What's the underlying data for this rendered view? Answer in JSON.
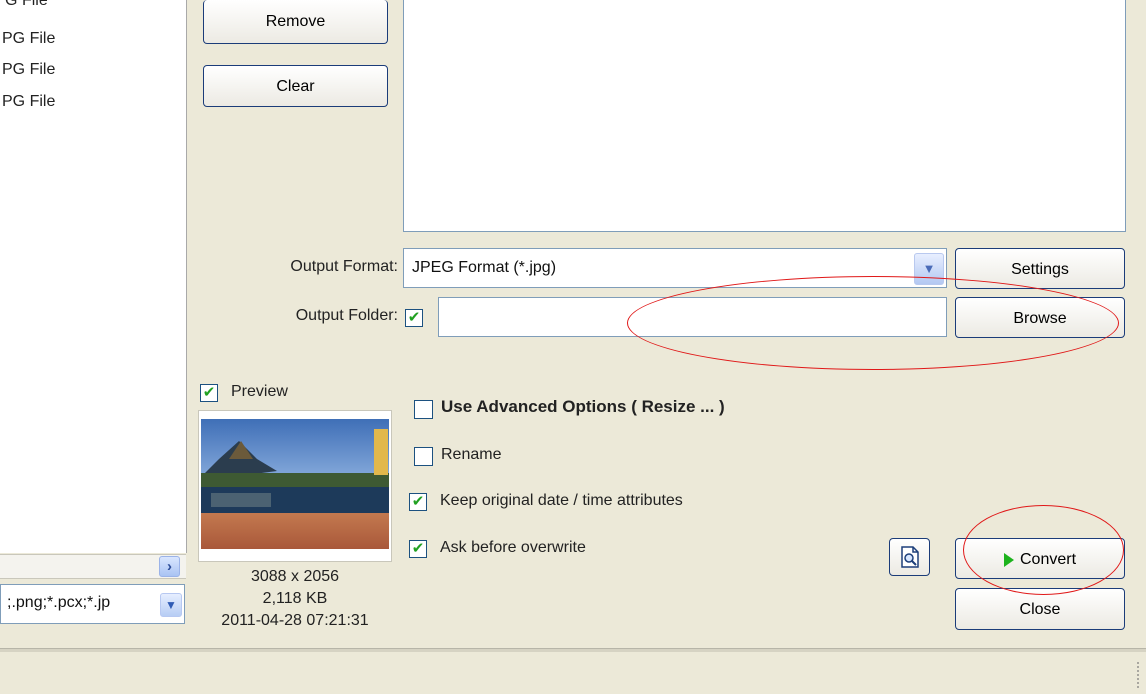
{
  "file_list": {
    "rows": [
      "'G File",
      "PG File",
      "PG File",
      "PG File"
    ]
  },
  "filter_combo": {
    "value": ";.png;*.pcx;*.jp"
  },
  "buttons": {
    "remove": "Remove",
    "clear": "Clear",
    "settings": "Settings",
    "browse": "Browse",
    "convert": "Convert",
    "close": "Close"
  },
  "output": {
    "format_label": "Output Format:",
    "format_value": "JPEG Format (*.jpg)",
    "folder_label": "Output Folder:",
    "folder_value": "",
    "folder_checked": true
  },
  "preview": {
    "label": "Preview",
    "checked": true,
    "dimensions": "3088 x 2056",
    "size": "2,118 KB",
    "date": "2011-04-28 07:21:31"
  },
  "options": {
    "advanced": {
      "label": "Use Advanced Options ( Resize ... )",
      "checked": false
    },
    "rename": {
      "label": "Rename",
      "checked": false
    },
    "keep_date": {
      "label": "Keep original date / time attributes",
      "checked": true
    },
    "ask_overwrite": {
      "label": "Ask before overwrite",
      "checked": true
    }
  },
  "colors": {
    "window_bg": "#ece9d8",
    "annotation_red": "#e01818",
    "check_green": "#21a121",
    "convert_arrow": "#1db31d"
  },
  "icons": {
    "preview_button": "magnifier-page-icon",
    "convert": "play-arrow-icon",
    "dropdown": "chevron-down-icon",
    "scroll_right": "chevron-right-icon"
  }
}
